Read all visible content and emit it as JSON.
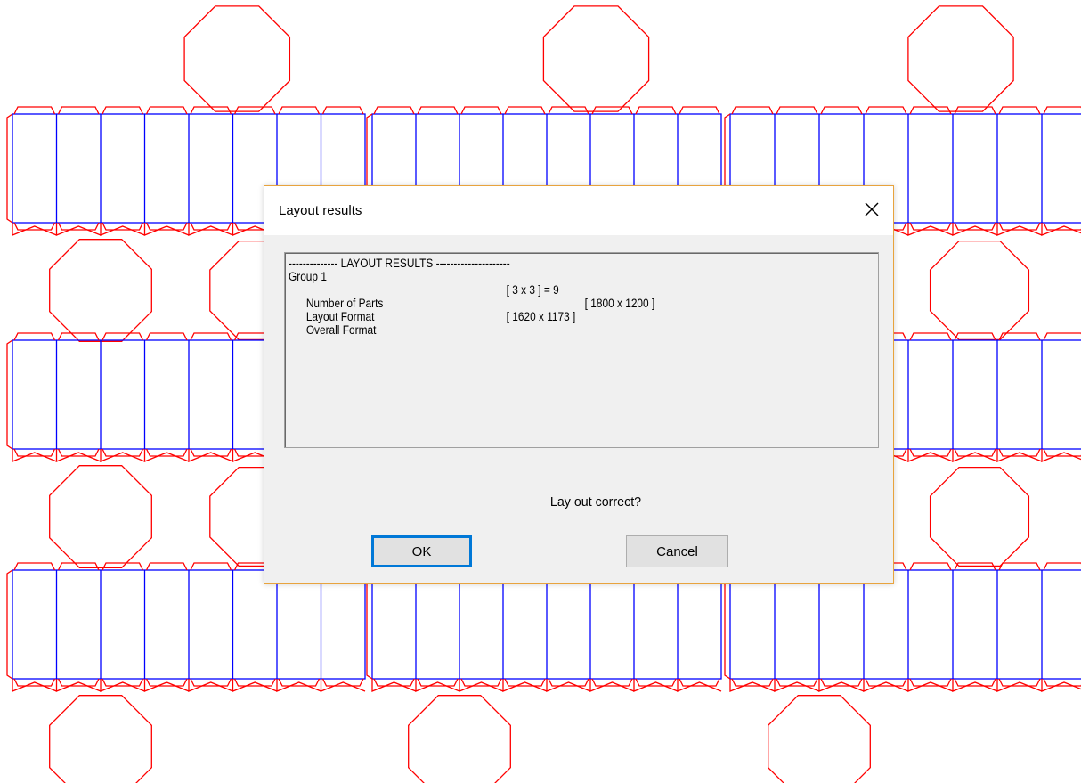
{
  "colors": {
    "cut_line": "#ff0000",
    "crease_line": "#0000ff",
    "dialog_border": "#e8a33d",
    "default_button_border": "#0078d7"
  },
  "background_layout": {
    "description_icon": "box-net-layout",
    "rows": 3,
    "columns": 3
  },
  "dialog": {
    "title": "Layout results",
    "close_icon": "close-icon",
    "results": {
      "header": "-------------- LAYOUT RESULTS ---------------------",
      "group": "Group 1",
      "rows": [
        {
          "label": "Number of Parts",
          "value": "[ 3 x 3 ] = 9"
        },
        {
          "label": "Layout Format",
          "value": "[ 1800 x 1200 ]"
        },
        {
          "label": "Overall Format",
          "value": "[ 1620 x 1173 ]"
        }
      ]
    },
    "question": "Lay out correct?",
    "ok_label": "OK",
    "cancel_label": "Cancel"
  }
}
